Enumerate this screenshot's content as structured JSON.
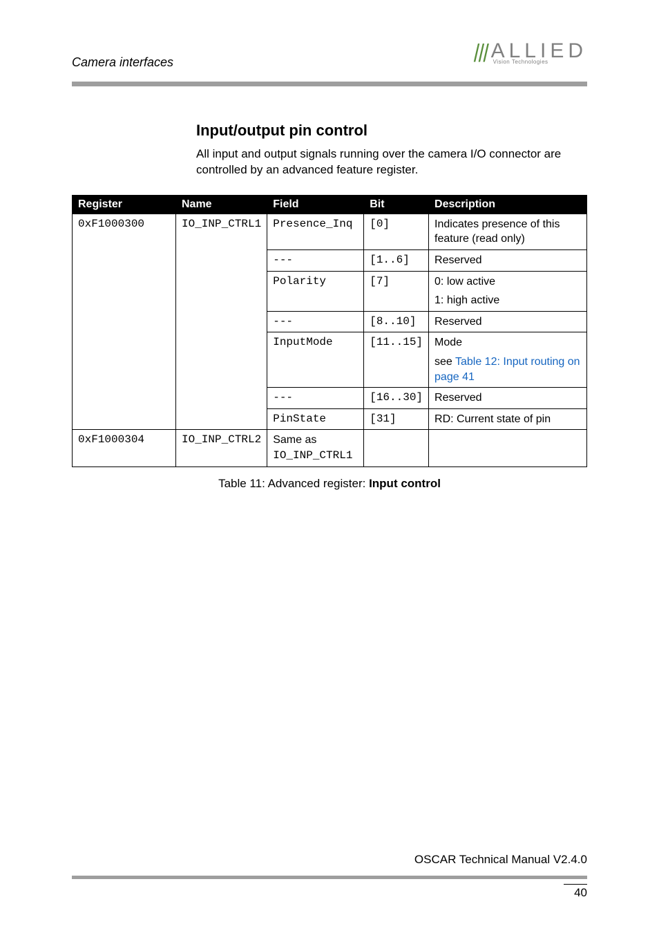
{
  "header": {
    "section": "Camera interfaces",
    "logo_brand": "ALLIED",
    "logo_sub": "Vision Technologies"
  },
  "section": {
    "title": "Input/output pin control",
    "intro": "All input and output signals running over the camera I/O connector are controlled by an advanced feature register."
  },
  "table": {
    "headers": {
      "register": "Register",
      "name": "Name",
      "field": "Field",
      "bit": "Bit",
      "description": "Description"
    },
    "rows": [
      {
        "register": "0xF1000300",
        "name": "IO_INP_CTRL1",
        "field": "Presence_Inq",
        "bit": "[0]",
        "desc": "Indicates presence of this feature (read only)"
      },
      {
        "field": "---",
        "bit": "[1..6]",
        "desc": "Reserved"
      },
      {
        "field": "Polarity",
        "bit": "[7]",
        "desc_a": "0: low active",
        "desc_b": "1: high active"
      },
      {
        "field": "---",
        "bit": "[8..10]",
        "desc": "Reserved"
      },
      {
        "field": "InputMode",
        "bit": "[11..15]",
        "desc_a": "Mode",
        "desc_pre": "see ",
        "desc_link": "Table 12: Input routing on page 41"
      },
      {
        "field": "---",
        "bit": "[16..30]",
        "desc": "Reserved"
      },
      {
        "field": "PinState",
        "bit": "[31]",
        "desc": "RD: Current state of pin"
      },
      {
        "register": "0xF1000304",
        "name": "IO_INP_CTRL2",
        "field_a": "Same as",
        "field_b": "IO_INP_CTRL1",
        "bit": "",
        "desc": ""
      }
    ],
    "caption_pre": "Table 11: Advanced register: ",
    "caption_bold": "Input control"
  },
  "footer": {
    "text": "OSCAR Technical Manual V2.4.0",
    "page": "40"
  }
}
